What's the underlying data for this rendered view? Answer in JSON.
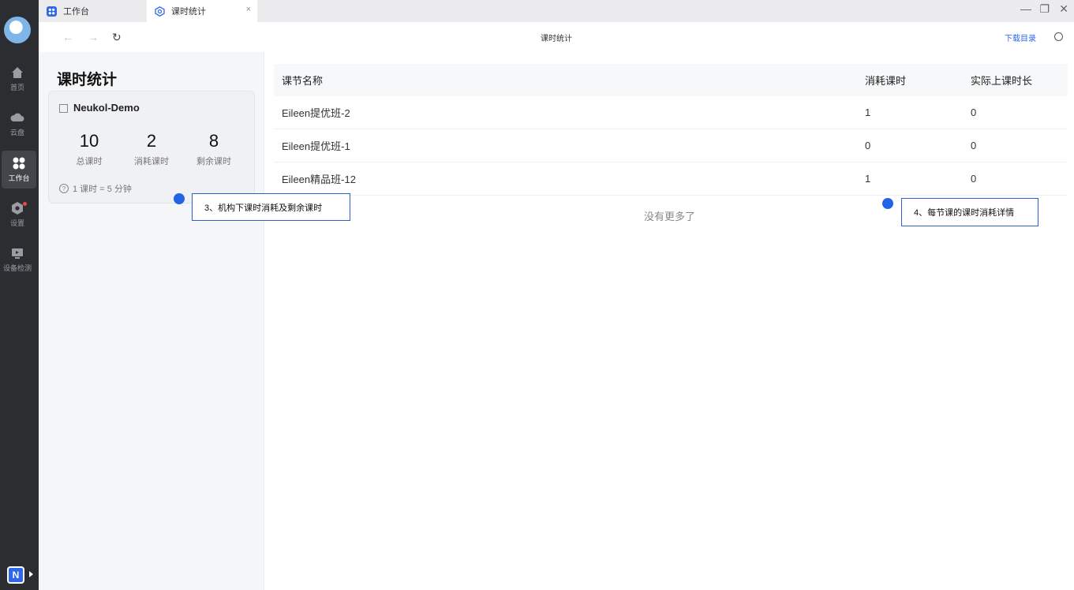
{
  "rail": {
    "items": [
      {
        "label": "首页",
        "icon": "home-icon"
      },
      {
        "label": "云盘",
        "icon": "cloud-icon"
      },
      {
        "label": "工作台",
        "icon": "workbench-icon"
      },
      {
        "label": "设置",
        "icon": "settings-icon"
      },
      {
        "label": "设备检测",
        "icon": "device-check-icon"
      }
    ],
    "badge_letter": "N"
  },
  "tabs": [
    {
      "label": "工作台"
    },
    {
      "label": "课时统计",
      "close": "×"
    }
  ],
  "window_controls": {
    "minimize": "—",
    "restore": "❐",
    "close": "✕"
  },
  "navbar": {
    "back": "←",
    "forward": "→",
    "refresh": "↻",
    "title": "课时统计",
    "download": "下载目录"
  },
  "left": {
    "page_title": "课时统计",
    "org_name": "Neukol-Demo",
    "stats": [
      {
        "value": "10",
        "label": "总课时"
      },
      {
        "value": "2",
        "label": "消耗课时"
      },
      {
        "value": "8",
        "label": "剩余课时"
      }
    ],
    "note_icon": "?",
    "note": "1 课时 = 5 分钟"
  },
  "table": {
    "headers": [
      "课节名称",
      "消耗课时",
      "实际上课时长"
    ],
    "rows": [
      [
        "Eileen提优班-2",
        "1",
        "0"
      ],
      [
        "Eileen提优班-1",
        "0",
        "0"
      ],
      [
        "Eileen精品班-12",
        "1",
        "0"
      ]
    ],
    "no_more": "没有更多了"
  },
  "annotations": [
    {
      "text": "3、机构下课时消耗及剩余课时"
    },
    {
      "text": "4、每节课的课时消耗详情"
    }
  ],
  "colors": {
    "accent": "#2e67e8",
    "rail": "#2c2d31",
    "annotation_dot": "#2264e5"
  }
}
